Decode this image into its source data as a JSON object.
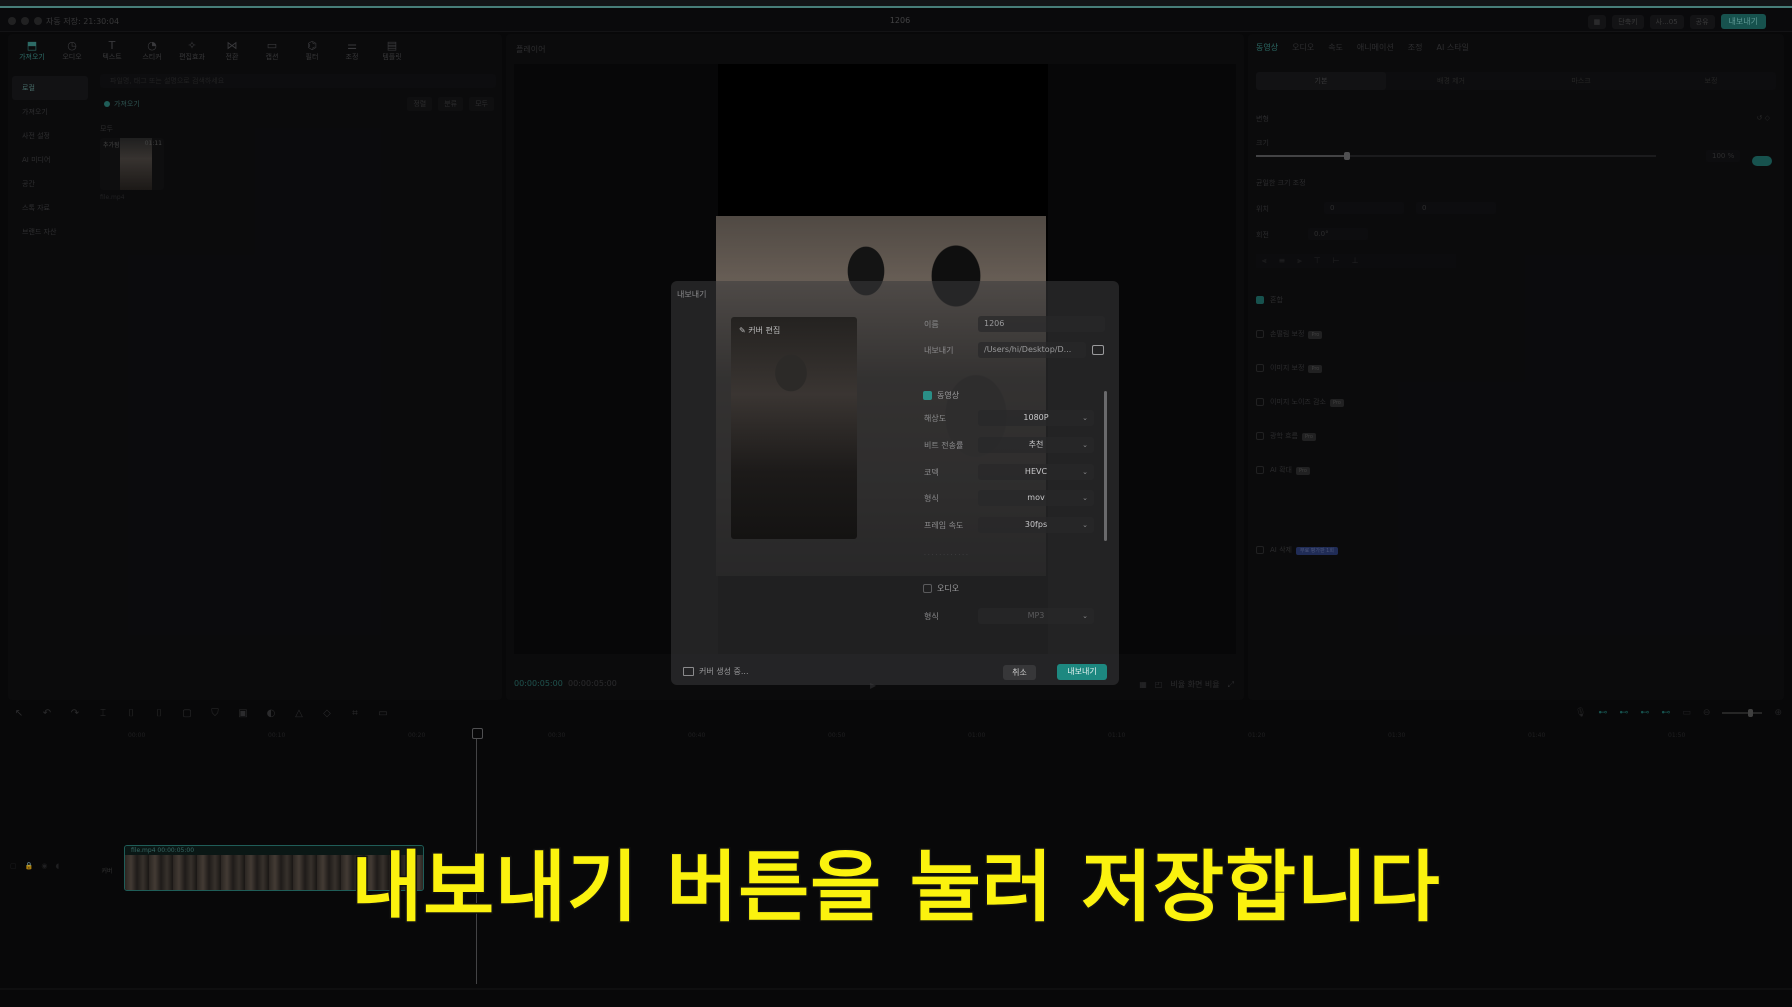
{
  "titlebar": {
    "autosave": "자동 저장: 21:30:04",
    "project_title": "1206",
    "chips": [
      "단축키",
      "사...05",
      "공유"
    ],
    "export_label": "내보내기"
  },
  "media_panel": {
    "tools": [
      {
        "icon": "import-icon",
        "label": "가져오기"
      },
      {
        "icon": "audio-icon",
        "label": "오디오"
      },
      {
        "icon": "text-icon",
        "label": "텍스트"
      },
      {
        "icon": "sticker-icon",
        "label": "스티커"
      },
      {
        "icon": "effects-icon",
        "label": "편집효과"
      },
      {
        "icon": "transition-icon",
        "label": "전환"
      },
      {
        "icon": "captions-icon",
        "label": "캡션"
      },
      {
        "icon": "filter-icon",
        "label": "필터"
      },
      {
        "icon": "adjust-icon",
        "label": "조정"
      },
      {
        "icon": "template-icon",
        "label": "템플릿"
      }
    ],
    "side_items": [
      "로컬",
      "가져오기",
      "사전 설정",
      "AI 미디어",
      "공간",
      "스톡 자료",
      "브랜드 자산"
    ],
    "search_placeholder": "파일명, 태그 또는 설명으로 검색하세요",
    "import_label": "가져오기",
    "filters": [
      "정렬",
      "분류",
      "모두"
    ],
    "all_label": "모두",
    "thumb": {
      "tag": "추가됨",
      "duration": "01:11",
      "name": "file.mp4"
    }
  },
  "player": {
    "title": "플레이어",
    "time_current": "00:00:05:00",
    "time_total": "00:00:05:00",
    "ratio_label": "비율 화면 비율"
  },
  "properties": {
    "tabs": [
      "동영상",
      "오디오",
      "속도",
      "애니메이션",
      "조정",
      "AI 스타일"
    ],
    "segments": [
      "기본",
      "배경 제거",
      "마스크",
      "보정"
    ],
    "transform_label": "변형",
    "scale_label": "크기",
    "scale_value": 0.22,
    "scale_text": "100 %",
    "uniform_label": "균일한 크기 조정",
    "position_label": "위치",
    "pos_x": "0",
    "pos_y": "0",
    "rotation_label": "회전",
    "rotation_value": "0.0°",
    "blend_label": "혼합",
    "options": [
      {
        "label": "손떨림 보정",
        "badge": "Pro"
      },
      {
        "label": "이미지 보정",
        "badge": "Pro"
      },
      {
        "label": "이미지 노이즈 감소",
        "badge": "Pro"
      },
      {
        "label": "광학 흐름",
        "badge": "Pro"
      },
      {
        "label": "AI 확대",
        "badge": "Pro"
      }
    ],
    "ai_remove_label": "AI 삭제",
    "ai_remove_badge": "무료 평가판 1회"
  },
  "timeline": {
    "tools": [
      "select-icon",
      "undo-icon",
      "redo-icon",
      "split-icon",
      "split-left-icon",
      "split-right-icon",
      "delete-icon",
      "marker-icon",
      "freeze-icon",
      "reverse-icon",
      "mirror-icon",
      "rotate-icon",
      "crop-icon",
      "ai-icon"
    ],
    "ticks": [
      "00:00",
      "00:10",
      "00:20",
      "00:30",
      "00:40",
      "00:50",
      "01:00",
      "01:10",
      "01:20",
      "01:30",
      "01:40",
      "01:50",
      "02:00"
    ],
    "clip_name": "file.mp4  00:00:05:00",
    "track_label": "커버"
  },
  "export_dialog": {
    "title": "내보내기",
    "cover_edit": "커버 편집",
    "name_label": "이름",
    "name_value": "1206",
    "export_to_label": "내보내기",
    "export_to_value": "/Users/hi/Desktop/D...",
    "video_section": "동영상",
    "resolution_label": "해상도",
    "resolution_value": "1080P",
    "bitrate_label": "비트 전송률",
    "bitrate_value": "추천",
    "codec_label": "코덱",
    "codec_value": "HEVC",
    "format_label": "형식",
    "format_value": "mov",
    "framerate_label": "프레임 속도",
    "framerate_value": "30fps",
    "audio_section": "오디오",
    "audio_format_label": "형식",
    "audio_format_value": "MP3",
    "footer_text": "커버 생성 중...",
    "cancel_label": "취소",
    "export_label": "내보내기"
  },
  "subtitle": "내보내기 버튼을 눌러 저장합니다",
  "colors": {
    "accent": "#1d8880",
    "subtitle": "#fbf20e",
    "background": "#0b0b0c"
  }
}
